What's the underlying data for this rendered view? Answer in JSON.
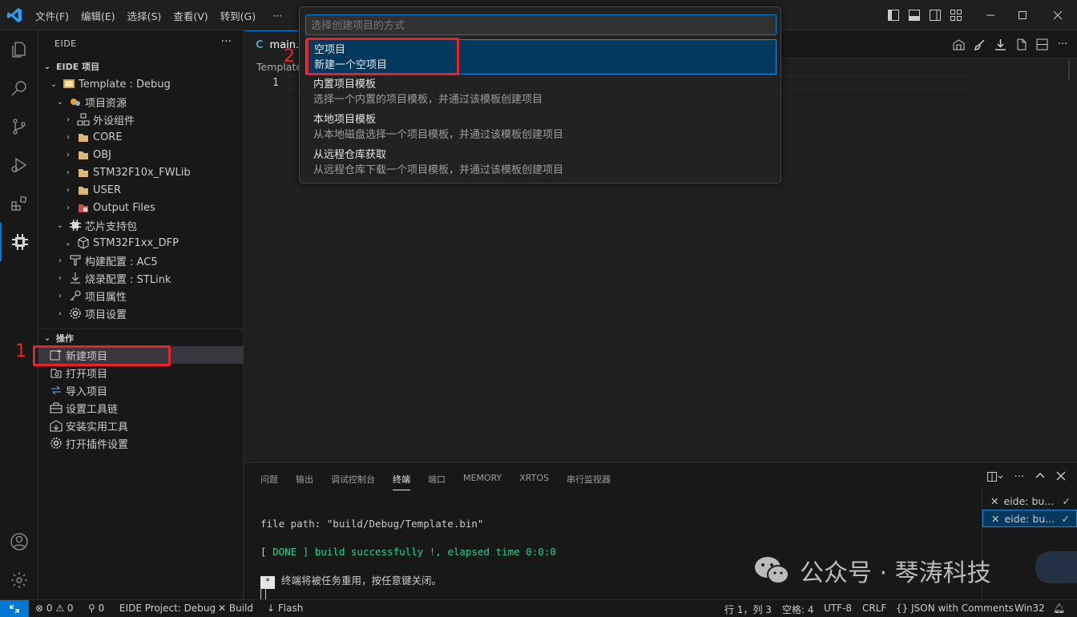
{
  "titlebar": {
    "menus": [
      "文件(F)",
      "编辑(E)",
      "选择(S)",
      "查看(V)",
      "转到(G)",
      "···"
    ]
  },
  "sidebar": {
    "title": "EIDE",
    "more": "···",
    "project_section": "EIDE 项目",
    "tree": [
      {
        "label": "Template : Debug",
        "icon": "project-icon"
      },
      {
        "label": "项目资源",
        "icon": "resources-icon"
      },
      {
        "label": "外设组件",
        "icon": "components-icon"
      },
      {
        "label": "CORE",
        "icon": "folder-icon"
      },
      {
        "label": "OBJ",
        "icon": "folder-icon"
      },
      {
        "label": "STM32F10x_FWLib",
        "icon": "folder-icon"
      },
      {
        "label": "USER",
        "icon": "folder-icon"
      },
      {
        "label": "Output Files",
        "icon": "output-folder-icon"
      },
      {
        "label": "芯片支持包",
        "icon": "chip-icon"
      },
      {
        "label": "STM32F1xx_DFP",
        "icon": "package-icon"
      },
      {
        "label": "构建配置 : AC5",
        "icon": "build-config-icon"
      },
      {
        "label": "烧录配置 : STLink",
        "icon": "flash-config-icon"
      },
      {
        "label": "项目属性",
        "icon": "key-icon"
      },
      {
        "label": "项目设置",
        "icon": "gear-icon"
      }
    ],
    "ops_section": "操作",
    "ops": [
      {
        "label": "新建项目",
        "icon": "new-project-icon"
      },
      {
        "label": "打开项目",
        "icon": "open-project-icon"
      },
      {
        "label": "导入项目",
        "icon": "import-project-icon"
      },
      {
        "label": "设置工具链",
        "icon": "toolchain-icon"
      },
      {
        "label": "安装实用工具",
        "icon": "install-tools-icon"
      },
      {
        "label": "打开插件设置",
        "icon": "plugin-settings-icon"
      }
    ]
  },
  "editor": {
    "tab_label": "main.c",
    "breadcrumb": "Template",
    "line_number": "1"
  },
  "quickpick": {
    "placeholder": "选择创建项目的方式",
    "items": [
      {
        "label": "空项目",
        "desc": "新建一个空项目"
      },
      {
        "label": "内置项目模板",
        "desc": "选择一个内置的项目模板，并通过该模板创建项目"
      },
      {
        "label": "本地项目模板",
        "desc": "从本地磁盘选择一个项目模板，并通过该模板创建项目"
      },
      {
        "label": "从远程仓库获取",
        "desc": "从远程仓库下载一个项目模板，并通过该模板创建项目"
      }
    ]
  },
  "panel": {
    "tabs": [
      "问题",
      "输出",
      "调试控制台",
      "终端",
      "端口",
      "MEMORY",
      "XRTOS",
      "串行监视器"
    ],
    "terminal": {
      "line1": "file path: \"build/Debug/Template.bin\"",
      "done_open": "[ ",
      "done_word": "DONE",
      "done_rest": " ] build successfully !, elapsed time 0:0:0",
      "line3": "终端将被任务重用，按任意键关闭。",
      "star": "*"
    },
    "terminals": [
      "eide: bu...",
      "eide: bu..."
    ]
  },
  "statusbar": {
    "problems": "⊗ 0 ⚠ 0",
    "ports": "0",
    "project": "EIDE Project: Debug",
    "build": "Build",
    "flash": "Flash",
    "position": "行 1，列 3",
    "spaces": "空格: 4",
    "encoding": "UTF-8",
    "eol": "CRLF",
    "language": "JSON with Comments",
    "platform": "Win32"
  },
  "annotations": {
    "one": "1",
    "two": "2"
  },
  "watermark": "公众号 · 琴涛科技",
  "colors": {
    "accent": "#0078d4",
    "annotation": "#e8212a",
    "terminal_green": "#23d18b"
  }
}
